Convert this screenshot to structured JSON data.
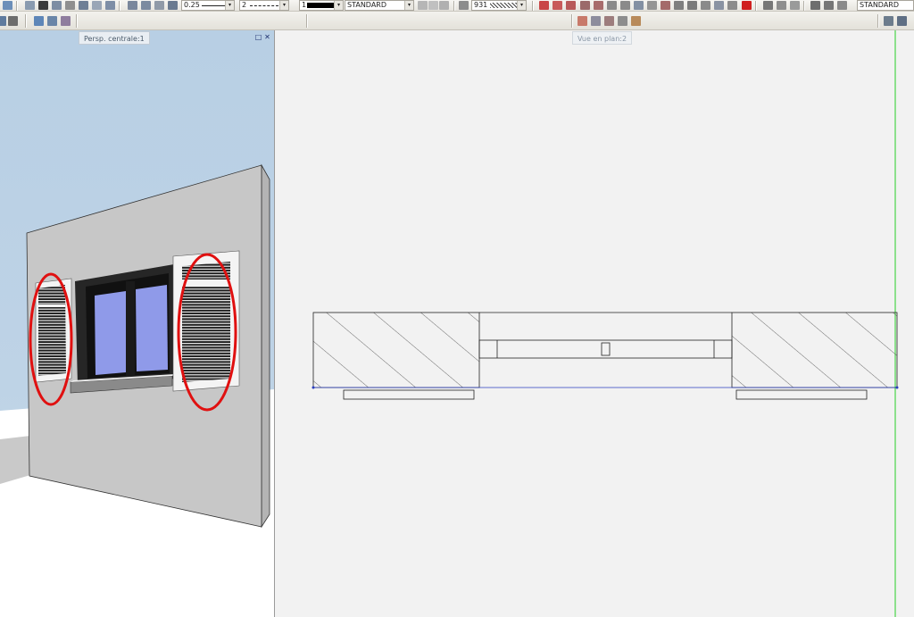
{
  "toolbar": {
    "line_weight": "0.25",
    "line_type": "2",
    "pen_number": "1",
    "layer": "STANDARD",
    "hatch_number": "931",
    "right_layer": "STANDARD",
    "dropdown_arrow": "▾"
  },
  "views": {
    "perspective_title": "Persp. centrale:1",
    "plan_title": "Vue en plan:2",
    "restore_glyph": "□",
    "close_glyph": "✕"
  },
  "colors": {
    "sky": "#bed3e6",
    "wall": "#c7c7c7",
    "glass": "#8f9ae9",
    "highlight": "#e01010",
    "plan_background": "#f2f2f2",
    "plan_axis": "#49d449"
  }
}
